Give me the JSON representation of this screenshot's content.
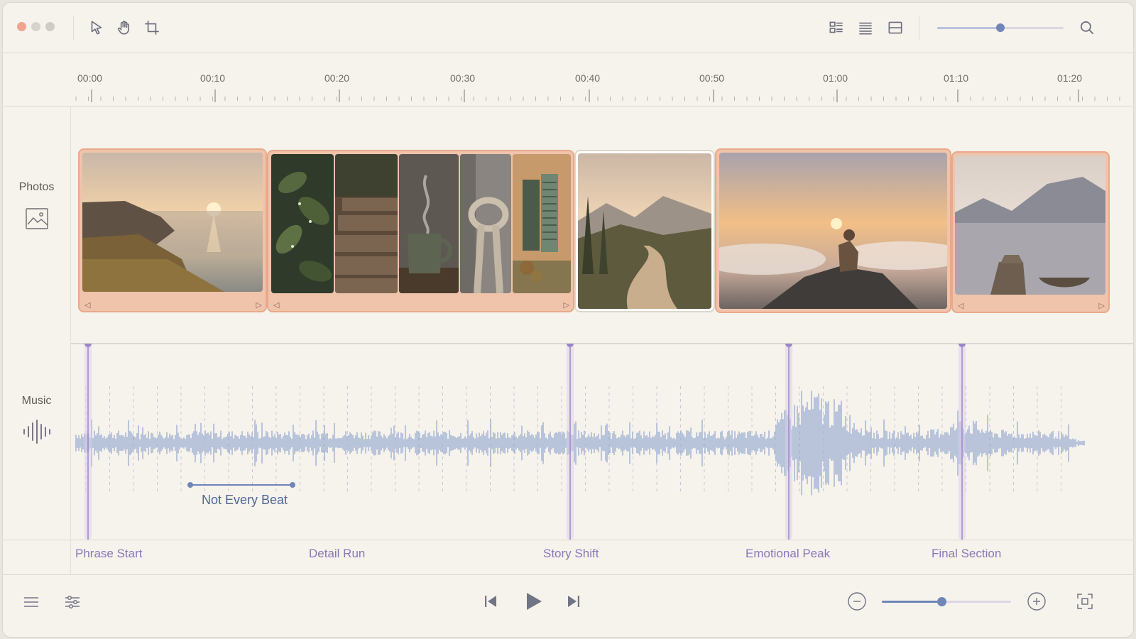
{
  "colors": {
    "window_close": "#f0a58f",
    "window_minimize": "#d6d3cf",
    "window_zoom": "#cfccc7",
    "accent": "#6f86b8",
    "clip_selected": "#f0c3ab",
    "marker": "#9b86c9",
    "waveform": "#9fb1d2"
  },
  "toolbar": {
    "tools": [
      "pointer-icon",
      "hand-icon",
      "crop-icon"
    ],
    "view_icons": [
      "storyboard-view-icon",
      "list-view-icon",
      "split-view-icon"
    ],
    "zoom_level": 0.5,
    "search_icon": "search-icon"
  },
  "ruler": {
    "labels": [
      "00:00",
      "00:10",
      "00:20",
      "00:30",
      "00:40",
      "00:50",
      "01:00",
      "01:10",
      "01:20"
    ]
  },
  "tracks": {
    "photos": {
      "label": "Photos",
      "icon": "image-icon"
    },
    "music": {
      "label": "Music",
      "icon": "waveform-icon"
    }
  },
  "clips": [
    {
      "name": "coastal-sunset",
      "selected": true
    },
    {
      "name": "detail-run",
      "selected": true,
      "frames": [
        "wet-leaves",
        "wooden-boardwalk",
        "steaming-mug",
        "rope-knot",
        "shuttered-window"
      ]
    },
    {
      "name": "winding-road",
      "selected": false
    },
    {
      "name": "summit-sunrise",
      "selected": true
    },
    {
      "name": "lake-dock",
      "selected": true
    }
  ],
  "annotation": {
    "label": "Not Every Beat"
  },
  "markers": [
    {
      "label": "Phrase Start"
    },
    {
      "label": "Detail Run"
    },
    {
      "label": "Story Shift"
    },
    {
      "label": "Emotional Peak"
    },
    {
      "label": "Final Section"
    }
  ],
  "bottom": {
    "left_icons": [
      "menu-icon",
      "sliders-icon"
    ],
    "transport": [
      "skip-back-icon",
      "play-icon",
      "skip-forward-icon"
    ],
    "zoom_level": 0.46,
    "right_icon": "fit-to-screen-icon"
  }
}
